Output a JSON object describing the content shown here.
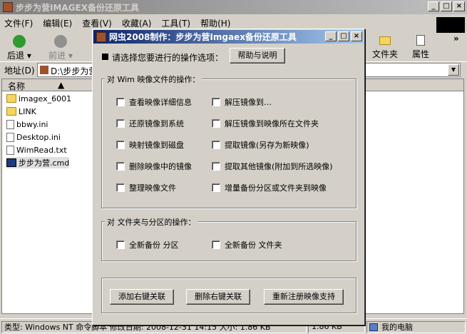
{
  "explorer": {
    "title": "步步为营IMAGEX备份还原工具",
    "menu": [
      "文件(F)",
      "编辑(E)",
      "查看(V)",
      "收藏(A)",
      "工具(T)",
      "帮助(H)"
    ],
    "toolbar": {
      "back": "后退",
      "forward": "前进",
      "folders": "文件夹",
      "properties": "属性",
      "more": "»"
    },
    "address_label": "地址(D)",
    "address_value": "D:\\步步为营",
    "column_name": "名称",
    "files": [
      {
        "name": "imagex_6001",
        "icon": "folder-icon"
      },
      {
        "name": "LINK",
        "icon": "folder-icon"
      },
      {
        "name": "bbwy.ini",
        "icon": "ini-file-icon"
      },
      {
        "name": "Desktop.ini",
        "icon": "ini-file-icon"
      },
      {
        "name": "WimRead.txt",
        "icon": "txt-file-icon"
      },
      {
        "name": "步步为营.cmd",
        "icon": "cmd-file-icon"
      }
    ],
    "status": {
      "type": "类型: Windows NT 命令脚本 修改日期: 2008-12-31 14:15 大小: 1.86 KB",
      "size": "1.86 KB",
      "location": "我的电脑"
    }
  },
  "dialog": {
    "title": "网虫2008制作：步步为营Imgaex备份还原工具",
    "prompt": "请选择您要进行的操作选项：",
    "help_button": "帮助与说明",
    "wim_group": {
      "label": "对 Wim 映像文件的操作：",
      "left": [
        "查看映像详细信息",
        "还原镜像到系统",
        "映射镜像到磁盘",
        "删除映像中的镜像",
        "整理映像文件"
      ],
      "right": [
        "解压镜像到…",
        "解压镜像到映像所在文件夹",
        "提取镜像(另存为新映像)",
        "提取其他镜像(附加到所选映像)",
        "增量备份分区或文件夹到映像"
      ]
    },
    "part_group": {
      "label": "对 文件夹与分区的操作：",
      "items": [
        "全新备份 分区",
        "全新备份 文件夹"
      ]
    },
    "buttons": [
      "添加右键关联",
      "删除右键关联",
      "重新注册映像支持"
    ]
  }
}
